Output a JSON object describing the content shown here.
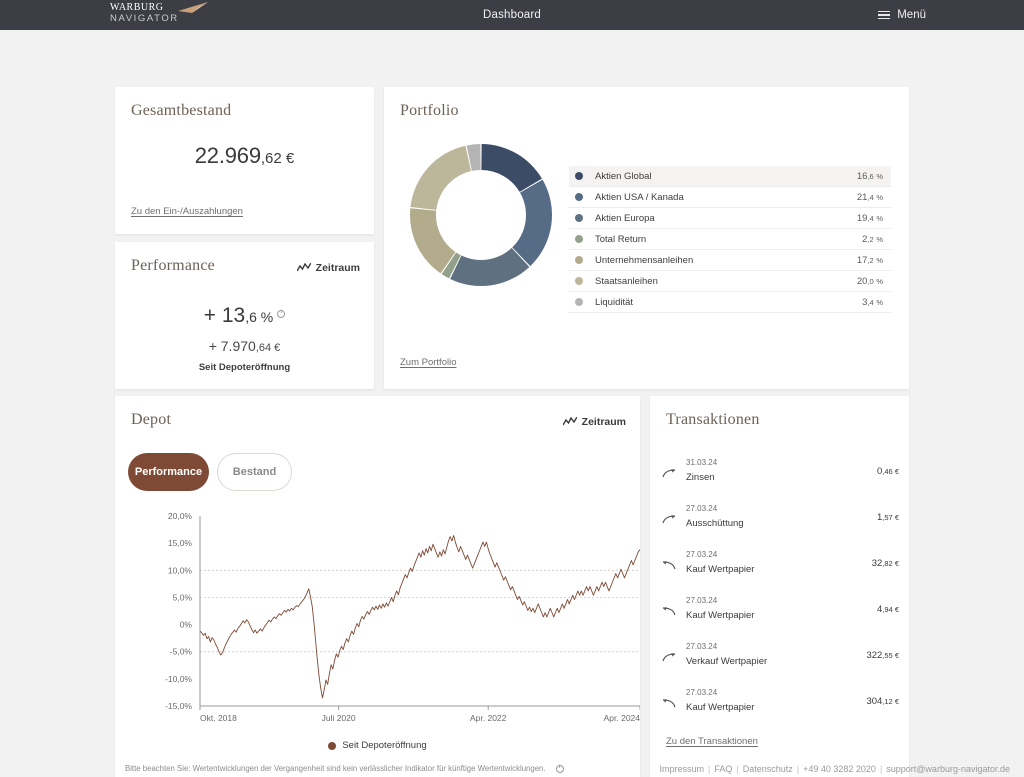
{
  "header": {
    "logo_top": "WARBURG",
    "logo_bottom": "NAVIGATOR",
    "title": "Dashboard",
    "menu_label": "Menü"
  },
  "gesamtbestand": {
    "title": "Gesamtbestand",
    "value_main": "22.969",
    "value_decimals": ",62 €",
    "link": "Zu den Ein-/Auszahlungen"
  },
  "performance": {
    "title": "Performance",
    "zeitraum_label": "Zeitraum",
    "percent_main": "+ 13",
    "percent_decimals": ",6",
    "percent_unit": " %",
    "amount_main": "+ 7.970",
    "amount_decimals": ",64 €",
    "note": "Seit Depoteröffnung"
  },
  "portfolio": {
    "title": "Portfolio",
    "link": "Zum Portfolio",
    "legend": [
      {
        "label": "Aktien Global",
        "value": "16",
        "decimals": ",6",
        "unit": "%",
        "color": "#3c4c67",
        "pct": 16.6
      },
      {
        "label": "Aktien USA / Kanada",
        "value": "21",
        "decimals": ",4",
        "unit": "%",
        "color": "#566b85",
        "pct": 21.4
      },
      {
        "label": "Aktien Europa",
        "value": "19",
        "decimals": ",4",
        "unit": "%",
        "color": "#5f7180",
        "pct": 19.4
      },
      {
        "label": "Total Return",
        "value": "2",
        "decimals": ",2",
        "unit": "%",
        "color": "#93a18c",
        "pct": 2.2
      },
      {
        "label": "Unternehmensanleihen",
        "value": "17",
        "decimals": ",2",
        "unit": "%",
        "color": "#b2ac8c",
        "pct": 17.2
      },
      {
        "label": "Staatsanleihen",
        "value": "20",
        "decimals": ",0",
        "unit": "%",
        "color": "#bcb79a",
        "pct": 20.0
      },
      {
        "label": "Liquidität",
        "value": "3",
        "decimals": ",4",
        "unit": "%",
        "color": "#b4b4b4",
        "pct": 3.4
      }
    ]
  },
  "depot": {
    "title": "Depot",
    "zeitraum_label": "Zeitraum",
    "tab_performance": "Performance",
    "tab_bestand": "Bestand",
    "legend_label": "Seit Depoteröffnung",
    "disclaimer": "Bitte beachten Sie: Wertentwicklungen der Vergangenheit sind kein verlässlicher Indikator für künftige Wertentwicklungen.",
    "series_color": "#7f4a35"
  },
  "transaktionen": {
    "title": "Transaktionen",
    "link": "Zu den Transaktionen",
    "items": [
      {
        "date": "31.03.24",
        "name": "Zinsen",
        "amount": "0",
        "decimals": ",46",
        "currency": " €",
        "icon": "arrow-incoming-icon"
      },
      {
        "date": "27.03.24",
        "name": "Ausschüttung",
        "amount": "1",
        "decimals": ",57",
        "currency": " €",
        "icon": "arrow-incoming-icon"
      },
      {
        "date": "27.03.24",
        "name": "Kauf Wertpapier",
        "amount": "32",
        "decimals": ",82",
        "currency": " €",
        "icon": "arrow-outgoing-icon"
      },
      {
        "date": "27.03.24",
        "name": "Kauf Wertpapier",
        "amount": "4",
        "decimals": ",94",
        "currency": " €",
        "icon": "arrow-outgoing-icon"
      },
      {
        "date": "27.03.24",
        "name": "Verkauf Wertpapier",
        "amount": "322",
        "decimals": ",55",
        "currency": " €",
        "icon": "arrow-incoming-icon"
      },
      {
        "date": "27.03.24",
        "name": "Kauf Wertpapier",
        "amount": "304",
        "decimals": ",12",
        "currency": " €",
        "icon": "arrow-outgoing-icon"
      }
    ]
  },
  "footer": {
    "links": [
      "Impressum",
      "FAQ",
      "Datenschutz",
      "+49 40 3282 2020",
      "support@warburg-navigator.de"
    ]
  },
  "chart_data": [
    {
      "type": "pie",
      "title": "Portfolio",
      "legend_position": "right",
      "categories": [
        "Aktien Global",
        "Aktien USA / Kanada",
        "Aktien Europa",
        "Total Return",
        "Unternehmensanleihen",
        "Staatsanleihen",
        "Liquidität"
      ],
      "values": [
        16.6,
        21.4,
        19.4,
        2.2,
        17.2,
        20.0,
        3.4
      ],
      "colors": [
        "#3c4c67",
        "#566b85",
        "#5f7180",
        "#93a18c",
        "#b2ac8c",
        "#bcb79a",
        "#b4b4b4"
      ],
      "unit": "%"
    },
    {
      "type": "line",
      "title": "Depot",
      "series_name": "Seit Depoteröffnung",
      "color": "#7f4a35",
      "xlabel": "",
      "ylabel": "",
      "grid": true,
      "ylim": [
        -15,
        20
      ],
      "ytick_labels": [
        "20,0%",
        "15,0%",
        "10,0%",
        "5,0%",
        "0%",
        "-5,0%",
        "-10,0%",
        "-15,0%"
      ],
      "ytick_values": [
        20,
        15,
        10,
        5,
        0,
        -5,
        -10,
        -15
      ],
      "xtick_labels": [
        "Okt. 2018",
        "Juli 2020",
        "Apr. 2022",
        "Apr. 2024"
      ],
      "xtick_positions": [
        0,
        0.315,
        0.655,
        1.0
      ],
      "values": [
        -1.2,
        -1.5,
        -2.0,
        -1.6,
        -2.6,
        -2.2,
        -3.2,
        -2.4,
        -2.8,
        -3.6,
        -4.2,
        -5.0,
        -5.6,
        -5.2,
        -4.4,
        -3.6,
        -3.0,
        -2.4,
        -1.8,
        -1.4,
        -1.0,
        -1.4,
        -0.7,
        -0.3,
        0.2,
        0.7,
        0.3,
        0.9,
        0.5,
        -0.2,
        -0.9,
        -1.5,
        -1.0,
        -1.6,
        -1.2,
        -0.8,
        -1.2,
        -0.6,
        -0.1,
        0.3,
        0.8,
        0.5,
        1.0,
        1.4,
        1.1,
        1.6,
        2.0,
        1.7,
        2.2,
        2.6,
        2.3,
        2.8,
        2.5,
        3.0,
        2.7,
        3.2,
        3.5,
        3.3,
        3.8,
        4.2,
        4.6,
        5.1,
        5.8,
        6.6,
        5.2,
        3.4,
        0.5,
        -3.0,
        -6.5,
        -9.5,
        -11.8,
        -13.5,
        -12.0,
        -10.2,
        -11.0,
        -9.0,
        -7.4,
        -8.2,
        -6.6,
        -5.4,
        -6.0,
        -4.8,
        -4.0,
        -4.6,
        -3.4,
        -2.6,
        -3.2,
        -2.0,
        -1.2,
        -1.8,
        -0.6,
        0.2,
        -0.4,
        0.8,
        1.5,
        1.0,
        1.8,
        2.4,
        1.9,
        2.6,
        3.2,
        2.7,
        3.4,
        2.8,
        3.6,
        3.0,
        3.8,
        3.2,
        4.0,
        3.4,
        4.2,
        5.0,
        4.2,
        5.4,
        6.2,
        5.5,
        6.8,
        7.6,
        8.4,
        9.2,
        8.6,
        9.6,
        10.4,
        9.8,
        10.8,
        11.6,
        12.4,
        13.2,
        12.4,
        13.6,
        12.8,
        14.0,
        13.2,
        14.4,
        13.6,
        14.8,
        14.0,
        13.2,
        12.4,
        13.4,
        12.6,
        13.8,
        13.0,
        14.2,
        15.4,
        16.2,
        15.4,
        16.4,
        15.2,
        14.2,
        13.4,
        14.4,
        13.6,
        12.8,
        12.0,
        12.8,
        12.0,
        11.2,
        10.4,
        11.2,
        12.0,
        12.8,
        13.6,
        14.4,
        15.2,
        14.4,
        15.2,
        14.0,
        13.0,
        12.2,
        11.4,
        10.6,
        11.4,
        10.6,
        9.8,
        9.0,
        8.2,
        8.8,
        8.0,
        7.2,
        6.4,
        7.0,
        6.2,
        5.4,
        4.6,
        5.2,
        4.4,
        3.6,
        4.2,
        3.4,
        2.6,
        3.2,
        2.4,
        3.0,
        2.2,
        3.0,
        3.8,
        3.0,
        2.2,
        1.4,
        2.2,
        1.4,
        2.2,
        3.0,
        2.2,
        1.4,
        2.2,
        3.0,
        2.2,
        3.0,
        3.8,
        3.0,
        3.8,
        4.6,
        3.8,
        4.6,
        5.4,
        4.6,
        5.4,
        6.2,
        5.4,
        6.2,
        5.4,
        6.2,
        7.0,
        6.2,
        7.0,
        6.2,
        5.4,
        6.2,
        7.0,
        6.2,
        7.0,
        7.8,
        7.0,
        7.8,
        7.0,
        6.2,
        7.0,
        7.8,
        8.6,
        9.4,
        8.6,
        9.4,
        10.2,
        9.4,
        8.6,
        9.4,
        10.2,
        11.0,
        11.8,
        11.0,
        11.8,
        12.6,
        13.4,
        13.8
      ]
    }
  ]
}
